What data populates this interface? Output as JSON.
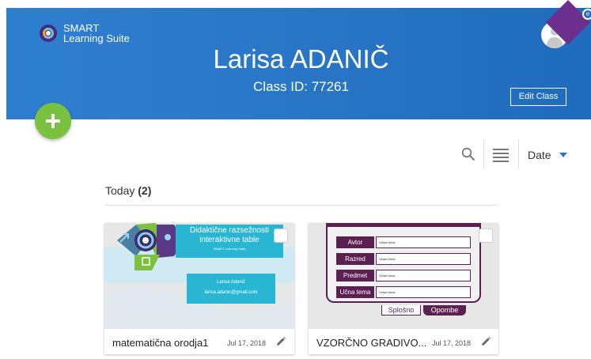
{
  "header": {
    "brand_line1": "SMART",
    "brand_line2": "Learning Suite",
    "title": "Larisa ADANIČ",
    "class_id": "Class ID: 77261",
    "edit_label": "Edit Class",
    "accent": "#2a77c8",
    "corner_mark": "e"
  },
  "toolbar": {
    "sort_label": "Date"
  },
  "section": {
    "label": "Today",
    "count": "(2)"
  },
  "cards": [
    {
      "name": "matematična orodja1",
      "date": "Jul 17, 2018",
      "thumb": {
        "title": "Didaktične razsežnosti interaktivne table",
        "subtitle": "SMART Learning Suite",
        "author": "Larisa Adanič",
        "email": "larisa.adanic@gmail.com"
      }
    },
    {
      "name": "VZORČNO GRADIVO...",
      "date": "Jul 17, 2018",
      "thumb": {
        "rows": [
          {
            "label": "Avtor",
            "value": "Vstavi tekst."
          },
          {
            "label": "Razred",
            "value": "Vstavi tekst."
          },
          {
            "label": "Predmet",
            "value": "Vstavi tekst."
          },
          {
            "label": "Učna tema",
            "value": "Vstavi tekst."
          }
        ],
        "tab1": "Splošno",
        "tab2": "Opombe"
      }
    }
  ]
}
